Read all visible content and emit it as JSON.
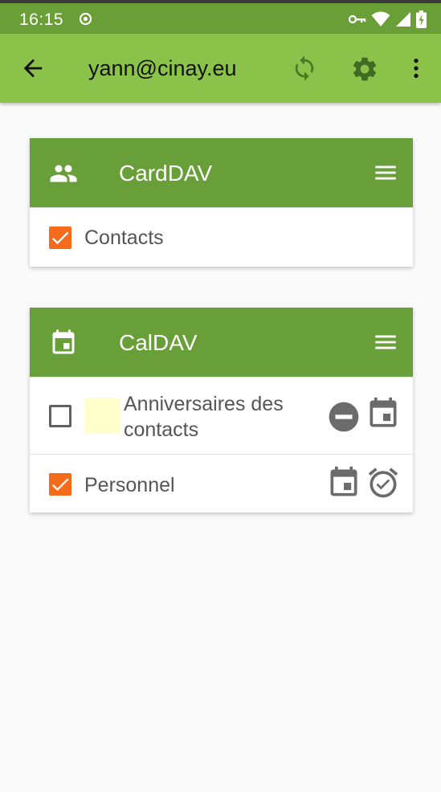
{
  "status_bar": {
    "time": "16:15",
    "icons": [
      "location-dot-icon",
      "vpn-key-icon",
      "wifi-icon",
      "signal-icon",
      "battery-icon"
    ]
  },
  "app_bar": {
    "title": "yann@cinay.eu",
    "icons": [
      "back-arrow-icon",
      "sync-icon",
      "settings-gear-icon",
      "more-vert-icon"
    ]
  },
  "carddav": {
    "title": "CardDAV",
    "icon": "people-icon",
    "items": [
      {
        "label": "Contacts",
        "checked": true
      }
    ]
  },
  "caldav": {
    "title": "CalDAV",
    "icon": "calendar-icon",
    "items": [
      {
        "label": "Anniversaires des contacts",
        "checked": false,
        "color": "#ffffcc",
        "icons": [
          "read-only-minus-icon",
          "calendar-icon"
        ]
      },
      {
        "label": "Personnel",
        "checked": true,
        "icons": [
          "calendar-icon",
          "alarm-check-icon"
        ]
      }
    ]
  },
  "colors": {
    "status_bar": "#6a9f37",
    "app_bar": "#8bc34a",
    "card_header": "#689f38",
    "checkbox_accent": "#f56b1c",
    "background": "#fafafa"
  }
}
